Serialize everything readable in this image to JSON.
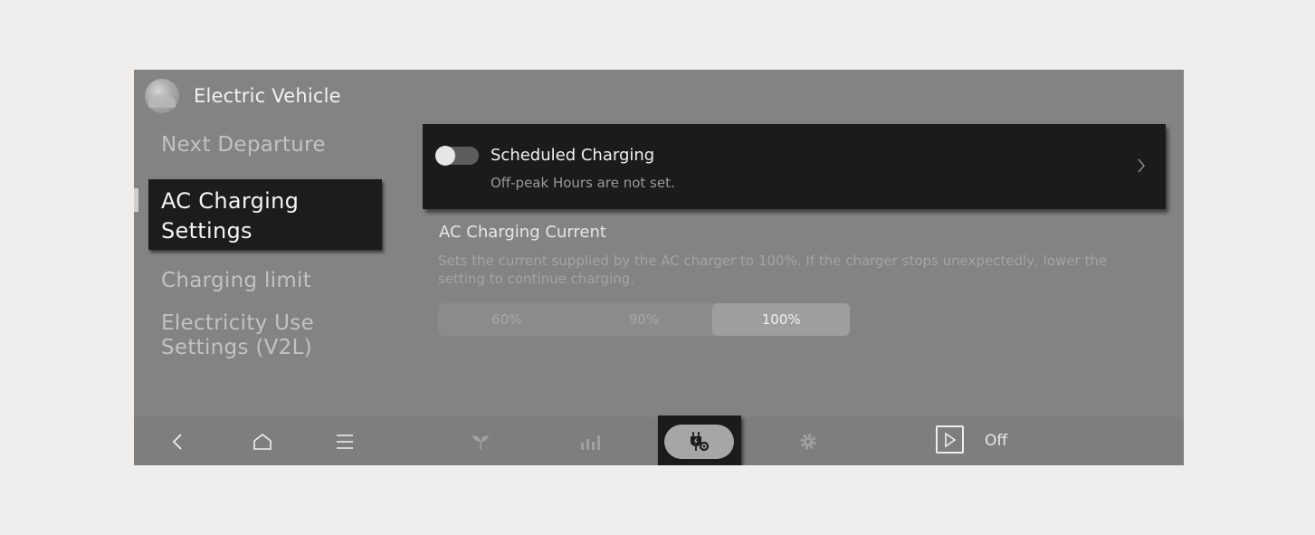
{
  "header": {
    "title": "Electric Vehicle",
    "avatar_icon": "landscape-avatar-icon"
  },
  "side_menu": {
    "items": [
      {
        "label": "Next Departure"
      },
      {
        "label": "AC Charging\nSettings",
        "selected": true
      },
      {
        "label": "Charging limit"
      },
      {
        "label": "Electricity Use\nSettings (V2L)"
      }
    ]
  },
  "scheduled_charging": {
    "title": "Scheduled Charging",
    "subtitle": "Off-peak Hours are not set.",
    "toggle_on": false
  },
  "ac_current": {
    "title": "AC Charging Current",
    "description": "Sets the current supplied by the AC charger to 100%. If the charger stops unexpectedly, lower the setting to continue charging.",
    "options": [
      "60%",
      "90%",
      "100%"
    ],
    "selected": "100%"
  },
  "bottom_bar": {
    "icons": [
      "back-icon",
      "home-icon",
      "menu-icon",
      "eco-leaf-icon",
      "bar-chart-icon",
      "ev-charging-settings-icon",
      "gear-icon",
      "play-icon"
    ],
    "status_label": "Off"
  },
  "colors": {
    "screen_bg": "#838383",
    "card_bg": "#1b1b1b",
    "active_pill": "#a6a6a6"
  }
}
